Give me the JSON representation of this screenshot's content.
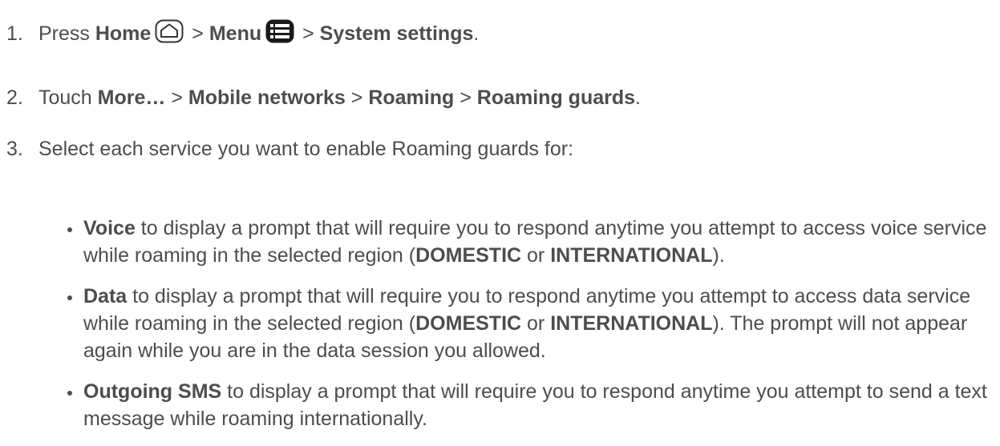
{
  "steps": [
    {
      "num": "1.",
      "press": "Press",
      "home": "Home",
      "sep1": ">",
      "menu": "Menu",
      "sep2": ">",
      "system_settings": "System settings",
      "end": "."
    },
    {
      "num": "2.",
      "touch": "Touch",
      "more": "More…",
      "sep1": ">",
      "mobile_networks": "Mobile networks",
      "sep2": ">",
      "roaming": "Roaming",
      "sep3": ">",
      "roaming_guards": "Roaming guards",
      "end": "."
    },
    {
      "num": "3.",
      "text": "Select each service you want to enable Roaming guards for:"
    }
  ],
  "bullets": [
    {
      "term": "Voice",
      "text1": " to display a prompt that will require you to respond anytime you attempt to access voice service while roaming in the selected region (",
      "domestic": "DOMESTIC",
      "or": " or ",
      "international": "INTERNATIONAL",
      "text2": ")."
    },
    {
      "term": "Data",
      "text1": " to display a prompt that will require you to respond anytime you attempt to access data service while roaming in the selected region (",
      "domestic": "DOMESTIC",
      "or": " or ",
      "international": "INTERNATIONAL",
      "text2": "). The prompt will not appear again while you are in the data session you allowed."
    },
    {
      "term": "Outgoing SMS",
      "text1": " to display a prompt that will require you to respond anytime you attempt to send a text message while roaming internationally."
    }
  ],
  "icons": {
    "home": "home-key-icon",
    "menu": "menu-key-icon"
  },
  "colors": {
    "text": "#4d4d4d",
    "icon": "#333333"
  }
}
